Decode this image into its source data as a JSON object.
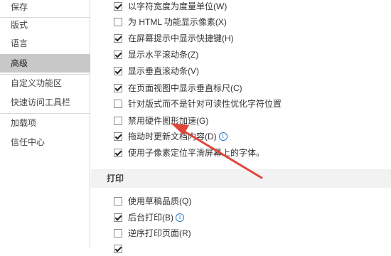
{
  "sidebar": {
    "items": [
      {
        "label": "保存"
      },
      {
        "label": "版式"
      },
      {
        "label": "语言"
      },
      {
        "label": "高级"
      },
      {
        "label": "自定义功能区"
      },
      {
        "label": "快速访问工具栏"
      },
      {
        "label": "加载项"
      },
      {
        "label": "信任中心"
      }
    ],
    "active": "高级"
  },
  "options": [
    {
      "label": "以字符宽度为度量单位(W)",
      "checked": true
    },
    {
      "label": "为 HTML 功能显示像素(X)",
      "checked": false
    },
    {
      "label": "在屏幕提示中显示快捷键(H)",
      "checked": true
    },
    {
      "label": "显示水平滚动条(Z)",
      "checked": true
    },
    {
      "label": "显示垂直滚动条(V)",
      "checked": true
    },
    {
      "label": "在页面视图中显示垂直标尺(C)",
      "checked": true
    },
    {
      "label": "针对版式而不是针对可读性优化字符位置",
      "checked": false
    },
    {
      "label": "禁用硬件图形加速(G)",
      "checked": false
    },
    {
      "label": "拖动时更新文档内容(D)",
      "checked": true
    },
    {
      "label": "使用子像素定位平滑屏幕上的字体。",
      "checked": true
    }
  ],
  "print_section": {
    "title": "打印",
    "options": [
      {
        "label": "使用草稿品质(Q)",
        "checked": false
      },
      {
        "label": "后台打印(B)",
        "checked": true
      },
      {
        "label": "逆序打印页面(R)",
        "checked": false
      }
    ]
  },
  "colors": {
    "active_nav": "#c8c8c8",
    "arrow": "#e0453a",
    "info": "#2b78c5"
  }
}
